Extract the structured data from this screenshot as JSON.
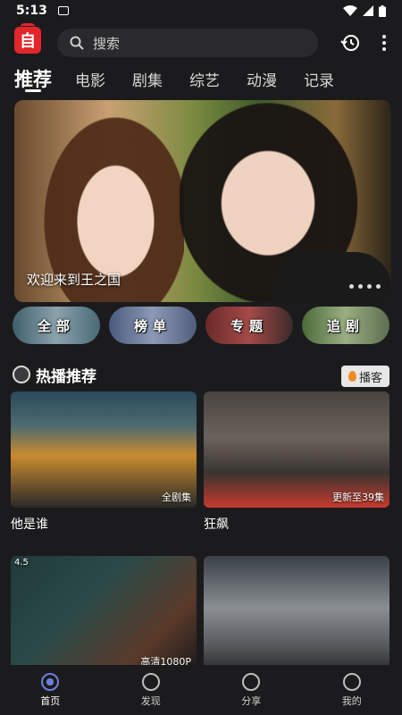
{
  "status": {
    "time": "5:13"
  },
  "search": {
    "placeholder": "搜索"
  },
  "tabs": [
    {
      "label": "推荐"
    },
    {
      "label": "电影"
    },
    {
      "label": "剧集"
    },
    {
      "label": "综艺"
    },
    {
      "label": "动漫"
    },
    {
      "label": "记录"
    }
  ],
  "banner": {
    "caption": "欢迎来到王之国",
    "page_dots": "•••"
  },
  "chips": [
    {
      "label": "全部"
    },
    {
      "label": "榜单"
    },
    {
      "label": "专题"
    },
    {
      "label": "追剧"
    }
  ],
  "section": {
    "title": "热播推荐",
    "more_label": "播客"
  },
  "cards": [
    {
      "title": "他是谁",
      "badge": "全剧集",
      "rating": ""
    },
    {
      "title": "狂飙",
      "badge": "更新至39集",
      "rating": ""
    },
    {
      "title": "",
      "badge": "高清1080P",
      "rating": "4.5"
    },
    {
      "title": "",
      "badge": "",
      "rating": ""
    }
  ],
  "nav": [
    {
      "label": "首页"
    },
    {
      "label": "发现"
    },
    {
      "label": "分享"
    },
    {
      "label": "我的"
    }
  ],
  "colors": {
    "background": "#1b1b1d",
    "logo": "#e3262b",
    "active_nav": "#6c7fd8"
  }
}
